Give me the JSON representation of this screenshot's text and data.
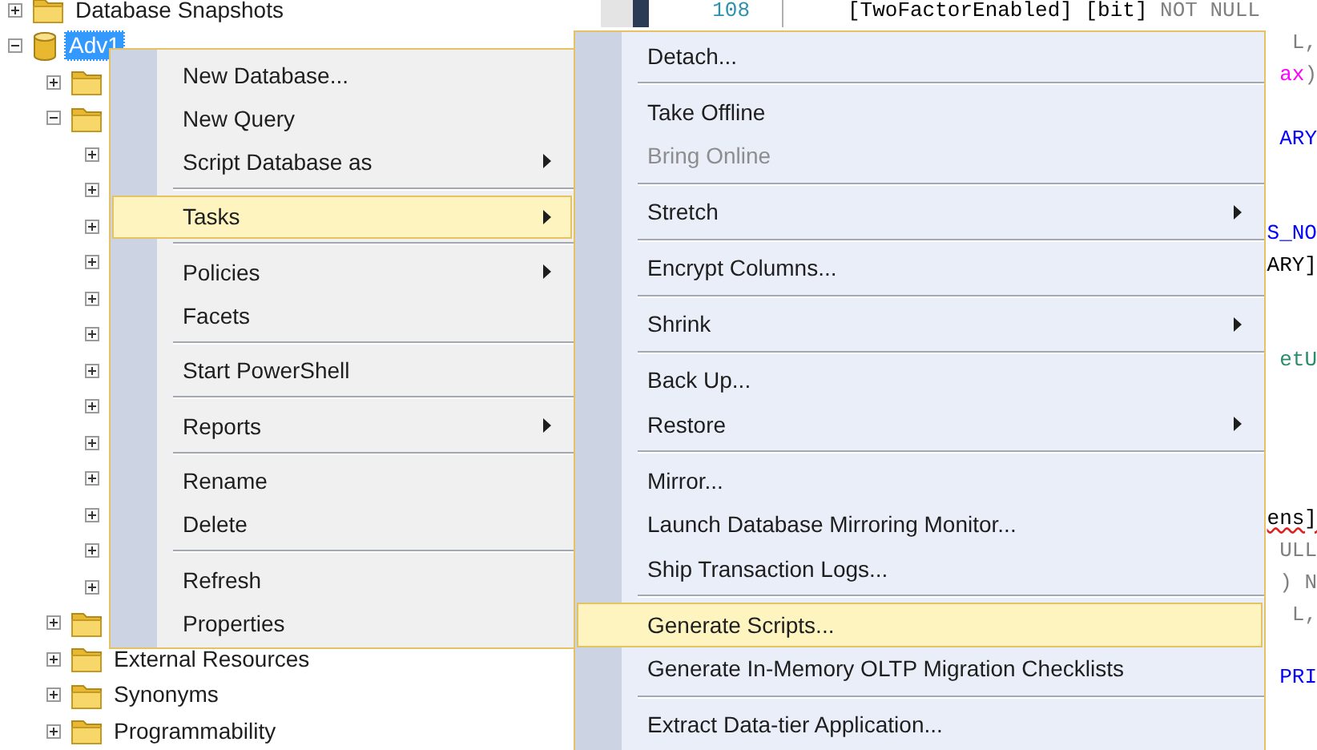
{
  "object_explorer": {
    "items": [
      {
        "label": "Database Snapshots",
        "kind": "folder",
        "expanded": false,
        "selected": false
      },
      {
        "label": "Adv1",
        "kind": "database",
        "expanded": true,
        "selected": true,
        "children": [
          {
            "kind": "folder",
            "expanded": false
          },
          {
            "kind": "folder",
            "expanded": true,
            "children": [
              {
                "expanded": false
              },
              {
                "expanded": false
              },
              {
                "expanded": false
              },
              {
                "expanded": false
              },
              {
                "expanded": false
              },
              {
                "expanded": false
              },
              {
                "expanded": false
              },
              {
                "expanded": false
              },
              {
                "expanded": false
              },
              {
                "expanded": false
              },
              {
                "expanded": false
              },
              {
                "expanded": false
              },
              {
                "expanded": false
              }
            ]
          },
          {
            "kind": "folder",
            "expanded": false
          },
          {
            "label": "External Resources",
            "kind": "folder",
            "expanded": false
          },
          {
            "label": "Synonyms",
            "kind": "folder",
            "expanded": false
          },
          {
            "label": "Programmability",
            "kind": "folder",
            "expanded": false
          }
        ]
      }
    ]
  },
  "editor": {
    "lines": [
      {
        "kind": "code",
        "number": "108",
        "segments": [
          {
            "text": "[TwoFactorEnabled]",
            "kind": "plain"
          },
          {
            "text": "[bit]",
            "kind": "plain"
          },
          {
            "text": "NOT NULL",
            "kind": "muted"
          }
        ]
      },
      {
        "kind": "code",
        "segments": [
          {
            "text": "L,",
            "kind": "muted"
          }
        ]
      },
      {
        "kind": "code",
        "segments": [
          {
            "text": "ax",
            "kind": "builtin"
          },
          {
            "text": ")",
            "kind": "muted"
          }
        ]
      },
      {
        "kind": "covered"
      },
      {
        "kind": "code",
        "segments": [
          {
            "text": "ARY",
            "kind": "keyword"
          }
        ]
      },
      {
        "kind": "covered"
      },
      {
        "kind": "covered"
      },
      {
        "kind": "code",
        "segments": [
          {
            "text": "S_NO",
            "kind": "keyword"
          }
        ]
      },
      {
        "kind": "code",
        "segments": [
          {
            "text": "ARY]",
            "kind": "plain"
          }
        ]
      },
      {
        "kind": "covered"
      },
      {
        "kind": "covered"
      },
      {
        "kind": "code",
        "segments": [
          {
            "text": "etU",
            "kind": "object"
          }
        ]
      },
      {
        "kind": "covered"
      },
      {
        "kind": "covered"
      },
      {
        "kind": "covered"
      },
      {
        "kind": "covered"
      },
      {
        "kind": "code",
        "segments": [
          {
            "text": "ens]",
            "kind": "plain",
            "error": true
          }
        ]
      },
      {
        "kind": "code",
        "segments": [
          {
            "text": "ULL",
            "kind": "muted"
          }
        ]
      },
      {
        "kind": "code",
        "segments": [
          {
            "text": ") N",
            "kind": "muted"
          }
        ]
      },
      {
        "kind": "code",
        "segments": [
          {
            "text": "L,",
            "kind": "muted"
          }
        ]
      },
      {
        "kind": "covered"
      },
      {
        "kind": "code",
        "segments": [
          {
            "text": "PRI",
            "kind": "keyword"
          }
        ]
      }
    ]
  },
  "context_menu": {
    "items": [
      {
        "kind": "item",
        "label": "New Database...",
        "submenu": false,
        "selected": false,
        "disabled": false
      },
      {
        "kind": "item",
        "label": "New Query",
        "submenu": false,
        "selected": false,
        "disabled": false
      },
      {
        "kind": "item",
        "label": "Script Database as",
        "submenu": true,
        "selected": false,
        "disabled": false
      },
      {
        "kind": "separator"
      },
      {
        "kind": "item",
        "label": "Tasks",
        "submenu": true,
        "selected": true,
        "disabled": false
      },
      {
        "kind": "separator"
      },
      {
        "kind": "item",
        "label": "Policies",
        "submenu": true,
        "selected": false,
        "disabled": false
      },
      {
        "kind": "item",
        "label": "Facets",
        "submenu": false,
        "selected": false,
        "disabled": false
      },
      {
        "kind": "separator"
      },
      {
        "kind": "item",
        "label": "Start PowerShell",
        "submenu": false,
        "selected": false,
        "disabled": false
      },
      {
        "kind": "separator"
      },
      {
        "kind": "item",
        "label": "Reports",
        "submenu": true,
        "selected": false,
        "disabled": false
      },
      {
        "kind": "separator"
      },
      {
        "kind": "item",
        "label": "Rename",
        "submenu": false,
        "selected": false,
        "disabled": false
      },
      {
        "kind": "item",
        "label": "Delete",
        "submenu": false,
        "selected": false,
        "disabled": false
      },
      {
        "kind": "separator"
      },
      {
        "kind": "item",
        "label": "Refresh",
        "submenu": false,
        "selected": false,
        "disabled": false
      },
      {
        "kind": "item",
        "label": "Properties",
        "submenu": false,
        "selected": false,
        "disabled": false
      }
    ]
  },
  "tasks_submenu": {
    "items": [
      {
        "kind": "item",
        "label": "Detach...",
        "submenu": false,
        "selected": false,
        "disabled": false
      },
      {
        "kind": "separator"
      },
      {
        "kind": "item",
        "label": "Take Offline",
        "submenu": false,
        "selected": false,
        "disabled": false
      },
      {
        "kind": "item",
        "label": "Bring Online",
        "submenu": false,
        "selected": false,
        "disabled": true
      },
      {
        "kind": "separator"
      },
      {
        "kind": "item",
        "label": "Stretch",
        "submenu": true,
        "selected": false,
        "disabled": false
      },
      {
        "kind": "separator"
      },
      {
        "kind": "item",
        "label": "Encrypt Columns...",
        "submenu": false,
        "selected": false,
        "disabled": false
      },
      {
        "kind": "separator"
      },
      {
        "kind": "item",
        "label": "Shrink",
        "submenu": true,
        "selected": false,
        "disabled": false
      },
      {
        "kind": "separator"
      },
      {
        "kind": "item",
        "label": "Back Up...",
        "submenu": false,
        "selected": false,
        "disabled": false
      },
      {
        "kind": "item",
        "label": "Restore",
        "submenu": true,
        "selected": false,
        "disabled": false
      },
      {
        "kind": "separator"
      },
      {
        "kind": "item",
        "label": "Mirror...",
        "submenu": false,
        "selected": false,
        "disabled": false
      },
      {
        "kind": "item",
        "label": "Launch Database Mirroring Monitor...",
        "submenu": false,
        "selected": false,
        "disabled": false
      },
      {
        "kind": "item",
        "label": "Ship Transaction Logs...",
        "submenu": false,
        "selected": false,
        "disabled": false
      },
      {
        "kind": "separator"
      },
      {
        "kind": "item",
        "label": "Generate Scripts...",
        "submenu": false,
        "selected": true,
        "disabled": false
      },
      {
        "kind": "item",
        "label": "Generate In-Memory OLTP Migration Checklists",
        "submenu": false,
        "selected": false,
        "disabled": false
      },
      {
        "kind": "separator"
      },
      {
        "kind": "item",
        "label": "Extract Data-tier Application...",
        "submenu": false,
        "selected": false,
        "disabled": false
      }
    ]
  }
}
